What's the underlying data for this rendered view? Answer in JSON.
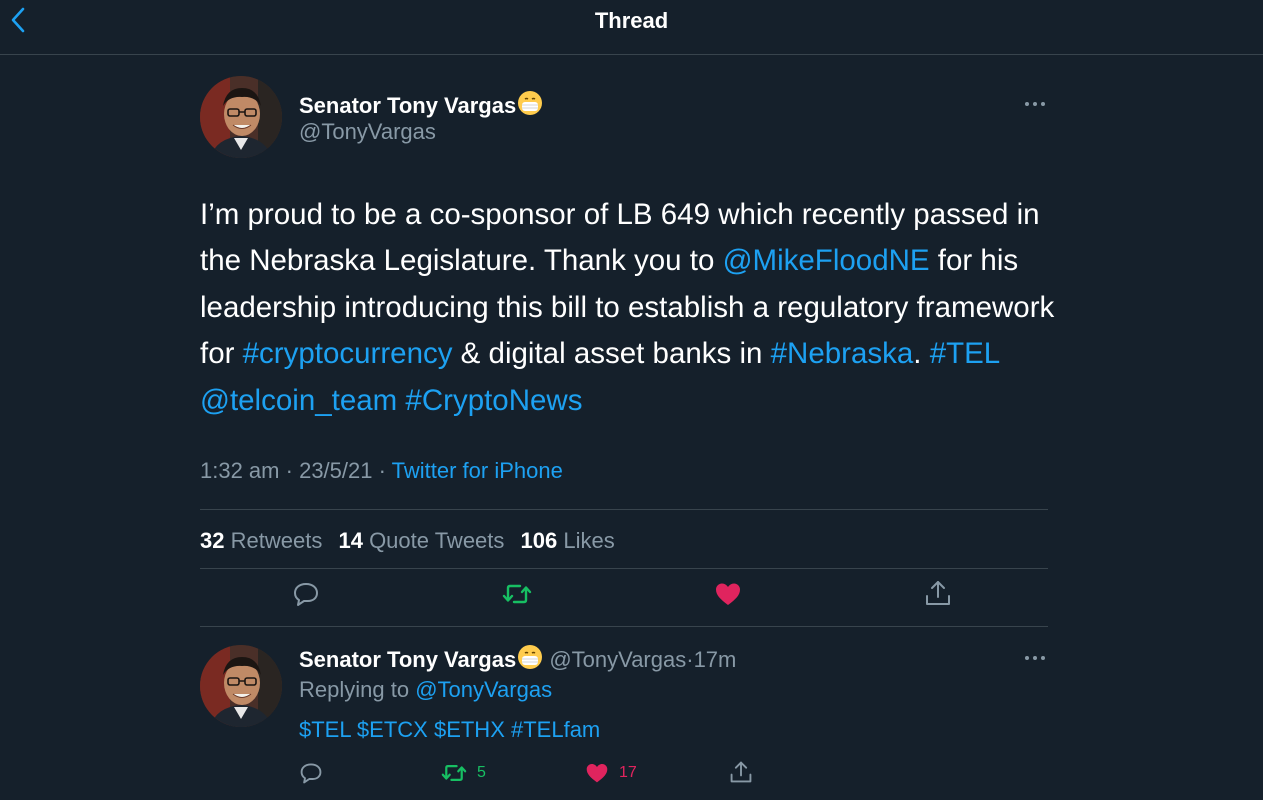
{
  "header": {
    "title": "Thread",
    "back_icon": "chevron-left-icon"
  },
  "colors": {
    "background": "#15202b",
    "link": "#1da1f2",
    "retweet": "#17bf63",
    "like": "#e0245e",
    "muted": "#8899a6"
  },
  "main_tweet": {
    "author_name": "Senator Tony Vargas",
    "author_emoji": "face-with-medical-mask-icon",
    "author_handle": "@TonyVargas",
    "text": {
      "t1": "I’m proud to be a co-sponsor of LB 649 which recently passed in the Nebraska Legislature. Thank you to ",
      "mention1": "@MikeFloodNE",
      "t2": " for his leadership introducing this bill to establish a regulatory framework for ",
      "hashtag1": "#cryptocurrency",
      "t3": " & digital asset banks in ",
      "hashtag2": "#Nebraska",
      "t4": ". ",
      "hashtag3": "#TEL",
      "t5": " ",
      "mention2": "@telcoin_team",
      "t6": " ",
      "hashtag4": "#CryptoNews"
    },
    "time": "1:32 am",
    "date": "23/5/21",
    "sep": "·",
    "source": "Twitter for iPhone",
    "stats": {
      "retweets_count": "32",
      "retweets_label": "Retweets",
      "quotes_count": "14",
      "quotes_label": "Quote Tweets",
      "likes_count": "106",
      "likes_label": "Likes"
    },
    "actions": [
      "reply-icon",
      "retweet-icon",
      "like-icon",
      "share-icon"
    ]
  },
  "reply_tweet": {
    "author_name": "Senator Tony Vargas",
    "author_handle": "@TonyVargas",
    "sep": "·",
    "time_ago": "17m",
    "replying_prefix": "Replying to ",
    "replying_to": "@TonyVargas",
    "tags": [
      "$TEL",
      "$ETCX",
      "$ETHX",
      "#TELfam"
    ],
    "retweet_count": "5",
    "like_count": "17"
  }
}
